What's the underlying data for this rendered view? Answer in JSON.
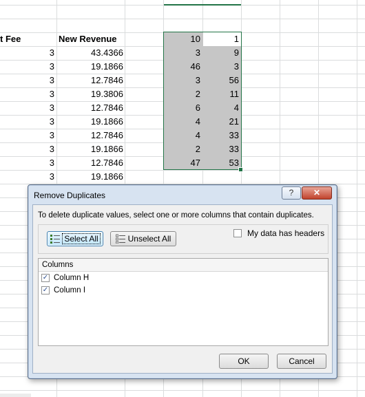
{
  "sheet": {
    "headers": {
      "fee": "t Fee",
      "revenue": "New Revenue"
    },
    "fee_values": [
      "3",
      "3",
      "3",
      "3",
      "3",
      "3",
      "3",
      "3",
      "3",
      "3"
    ],
    "revenue_values": [
      "43.4366",
      "19.1866",
      "12.7846",
      "19.3806",
      "12.7846",
      "19.1866",
      "12.7846",
      "19.1866",
      "12.7846",
      "19.1866"
    ],
    "col_h_values": [
      "10",
      "3",
      "46",
      "3",
      "2",
      "6",
      "4",
      "4",
      "2",
      "47"
    ],
    "col_i_values": [
      "1",
      "9",
      "3",
      "56",
      "11",
      "4",
      "21",
      "33",
      "33",
      "53"
    ],
    "selection_color": "#217346"
  },
  "dialog": {
    "title": "Remove Duplicates",
    "help_label": "?",
    "close_label": "✕",
    "instruction": "To delete duplicate values, select one or more columns that contain duplicates.",
    "select_all_label": "Select All",
    "unselect_all_label": "Unselect All",
    "headers_checkbox_label": "My data has headers",
    "headers_checked": false,
    "columns_header": "Columns",
    "columns": [
      {
        "label": "Column H",
        "checked": true
      },
      {
        "label": "Column I",
        "checked": true
      }
    ],
    "ok_label": "OK",
    "cancel_label": "Cancel"
  }
}
